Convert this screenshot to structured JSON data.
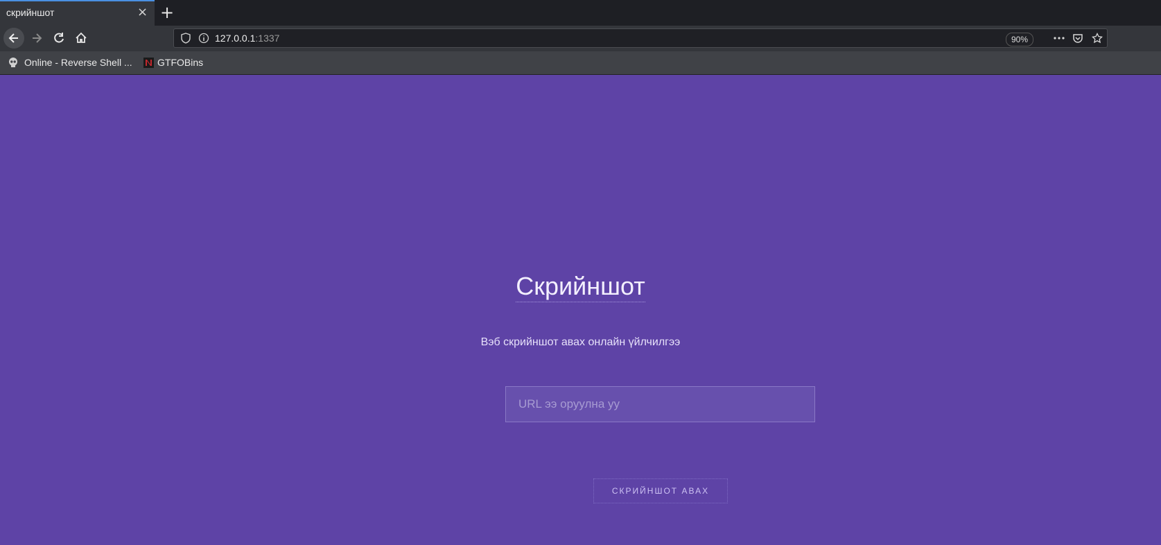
{
  "browser": {
    "tab_title": "скрийншот",
    "tab_close": "×",
    "new_tab": "+",
    "url_host": "127.0.0.1",
    "url_port": ":1337",
    "zoom": "90%",
    "bookmarks": [
      {
        "label": "Online - Reverse Shell ..."
      },
      {
        "label": "GTFOBins"
      }
    ]
  },
  "page": {
    "title": "Скрийншот",
    "subtitle": "Вэб скрийншот авах онлайн үйлчилгээ",
    "url_input_placeholder": "URL ээ оруулна уу",
    "submit_label": "СКРИЙНШОТ АВАХ"
  },
  "colors": {
    "background": "#5e43a6",
    "tab_accent": "#4a90e2"
  },
  "icons": {
    "back": "arrow-left-icon",
    "forward": "arrow-right-icon",
    "reload": "reload-icon",
    "home": "home-icon",
    "shield": "shield-icon",
    "info": "info-icon",
    "more": "more-icon",
    "pocket": "pocket-icon",
    "bookmark": "star-icon"
  }
}
